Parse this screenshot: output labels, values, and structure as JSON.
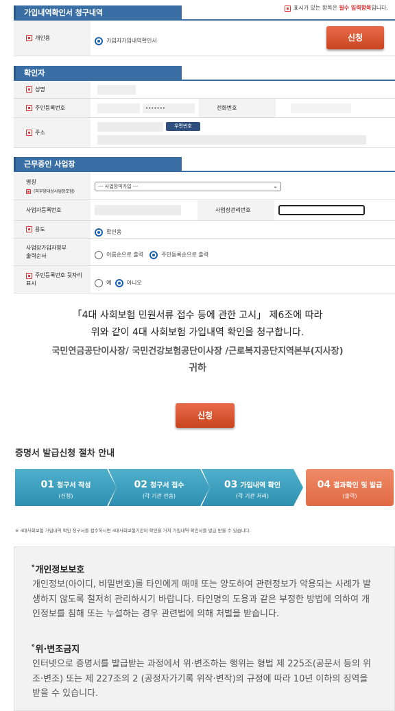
{
  "top_note": {
    "prefix": "표시가 있는 항목은 ",
    "required": "필수 입력항목",
    "suffix": "입니다."
  },
  "section1": {
    "title": "가입내역확인서 청구내역",
    "purpose_label": "개인용",
    "purpose_option": "가입자가입내역확인서",
    "apply_label": "신청"
  },
  "section2": {
    "title": "확인자",
    "name_label": "성명",
    "rrn_label": "주민등록번호",
    "rrn_masked": "•••••••",
    "phone_label": "전화번호",
    "address_label": "주소",
    "zip_button": "우편번호"
  },
  "section3": {
    "title": "근무중인 사업장",
    "company_label": "명칭",
    "company_sub": "(피부양대상사업장포함)",
    "company_select": "--- 사업장미가입 ---",
    "bizno_label": "사업자등록번호",
    "mgmtno_label": "사업장관리번호",
    "use_label": "용도",
    "use_option": "확인용",
    "order_label_1": "사업장가입자명부",
    "order_label_2": "출력순서",
    "order_opt1": "이름순으로 출력",
    "order_opt2": "주민등록순으로 출력",
    "rrn_back_label_1": "주민등록번호 뒷자리",
    "rrn_back_label_2": "표시",
    "yes": "예",
    "no": "아니오"
  },
  "notice": {
    "line1": "「4대 사회보험 민원서류 접수 등에 관한 고시」 제6조에 따라",
    "line2": "위와 같이 4대 사회보험 가입내역 확인을 청구합니다.",
    "to_line1": "국민연금공단이사장/ 국민건강보험공단이사장 /근로복지공단지역본부(지사장)",
    "to_line2": "귀하"
  },
  "submit_label": "신청",
  "procedure": {
    "title": "증명서 발급신청 절차 안내",
    "steps": [
      {
        "num": "01",
        "title": "청구서 작성",
        "sub": "(신청)"
      },
      {
        "num": "02",
        "title": "청구서 접수",
        "sub": "(각 기관 전송)"
      },
      {
        "num": "03",
        "title": "가입내역 확인",
        "sub": "(각 기관 처리)"
      },
      {
        "num": "04",
        "title": "결과확인 및 발급",
        "sub": "(출력)"
      }
    ],
    "footnote": "※ 4대사회보험 가입내역 확인 청구서를 접수하시면 4대사회보험기관의 확인을 거쳐 가입내역 확인서를 발급 받을 수 있습니다."
  },
  "privacy": {
    "title": "개인정보보호",
    "body": "개인정보(아이디, 비밀번호)를 타인에게 매매 또는 양도하여 관련정보가 악용되는 사례가 발생하지 않도록 철저히 관리하시기 바랍니다. 타인명의 도용과 같은 부정한 방법에 의하여 개인정보를 침해 또는 누설하는 경우 관련법에 의해 처벌을 받습니다."
  },
  "forgery": {
    "title": "위·변조금지",
    "body": "인터넷으로 증명서를 발급받는 과정에서 위·변조하는 행위는 형법 제 225조(공문서 등의 위조·변조) 또는 제 227조의 2 (공정자가기록 위작·변작)의 규정에 따라 10년 이하의 징역을 받을 수 있습니다."
  }
}
